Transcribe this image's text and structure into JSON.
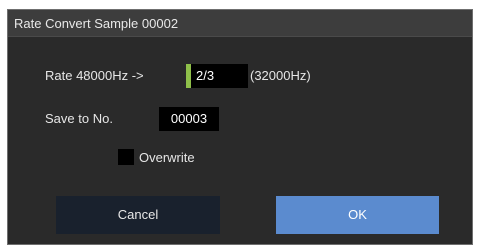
{
  "dialog": {
    "title": "Rate Convert Sample 00002",
    "rate_label": "Rate 48000Hz ->",
    "rate_value": "2/3",
    "rate_result": "(32000Hz)",
    "save_to_label": "Save to No.",
    "save_to_value": "00003",
    "overwrite_label": "Overwrite",
    "overwrite_checked": false,
    "cancel_label": "Cancel",
    "ok_label": "OK",
    "colors": {
      "background": "#2a2a2a",
      "field": "#000000",
      "rate_accent": "#8fc04a",
      "cancel_button": "#19212d",
      "ok_button": "#5b8bcf"
    }
  }
}
